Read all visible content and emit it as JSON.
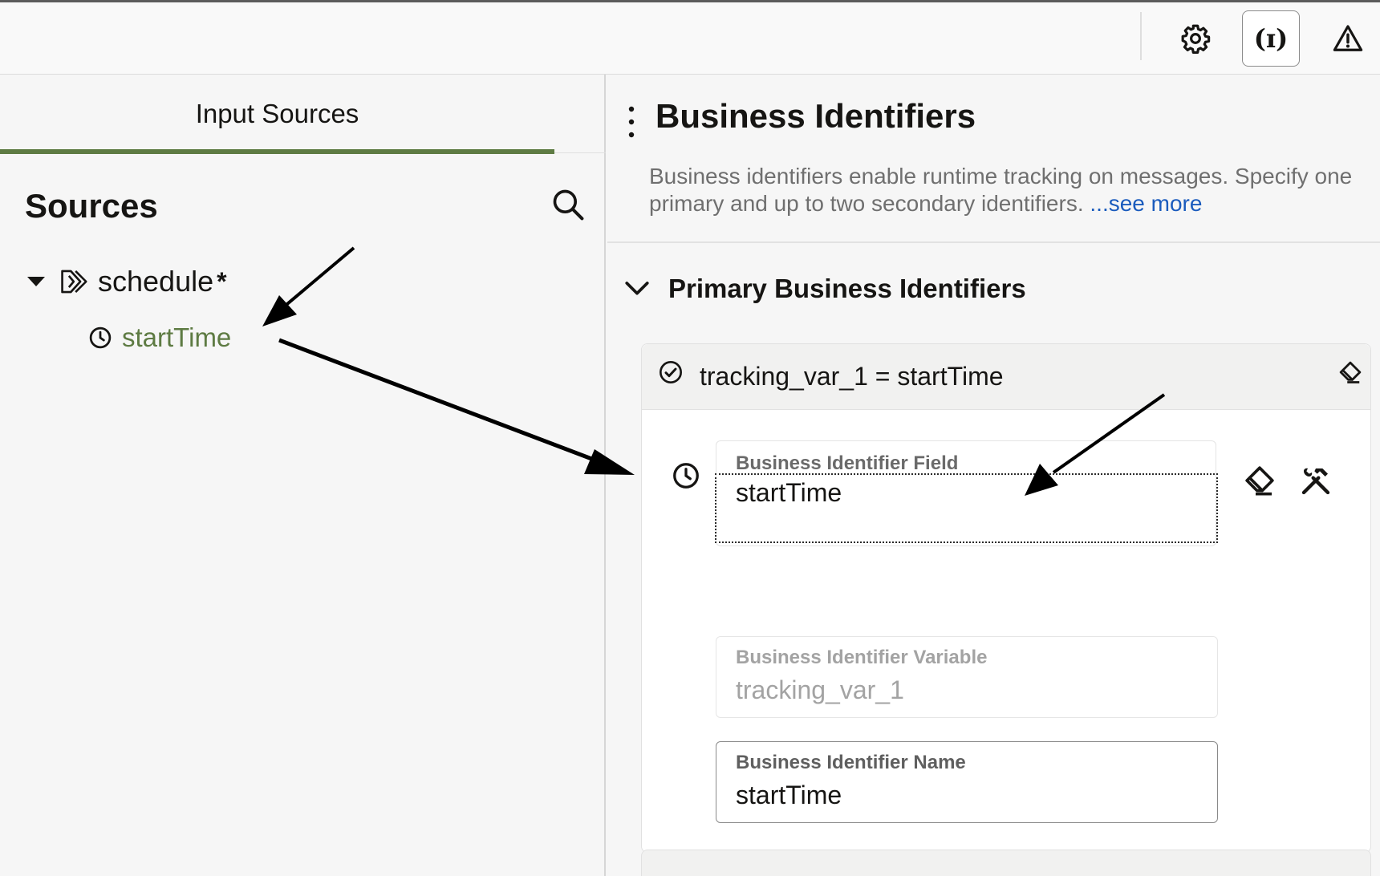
{
  "toolbar": {
    "settings_icon": "gear-icon",
    "expression_glyph": "(ɪ)",
    "warning_icon": "warning-icon"
  },
  "left_pane": {
    "tab_label": "Input Sources",
    "sources_title": "Sources",
    "search_icon": "search-icon",
    "tree": {
      "parent_label": "schedule",
      "parent_required": "*",
      "child_label": "startTime"
    }
  },
  "right_pane": {
    "title": "Business Identifiers",
    "description": "Business identifiers enable runtime tracking on messages. Specify one primary and up to two secondary identifiers.",
    "see_more": "...see more",
    "section_title": "Primary Business Identifiers",
    "card": {
      "summary": "tracking_var_1 = startTime",
      "field": {
        "label": "Business Identifier Field",
        "value": "startTime"
      },
      "variable": {
        "label": "Business Identifier Variable",
        "value": "tracking_var_1"
      },
      "name": {
        "label": "Business Identifier Name",
        "value": "startTime"
      }
    }
  },
  "colors": {
    "accent_green": "#5e7b43",
    "link_blue": "#1a5bbd",
    "text_primary": "#161513"
  }
}
